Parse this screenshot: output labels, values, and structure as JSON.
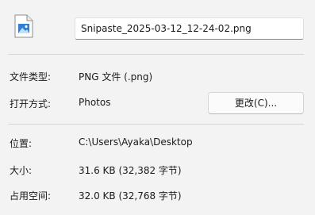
{
  "file": {
    "icon": "image-file-icon",
    "name": "Snipaste_2025-03-12_12-24-02.png"
  },
  "properties": {
    "type": {
      "label": "文件类型:",
      "value": "PNG 文件 (.png)"
    },
    "opens_with": {
      "label": "打开方式:",
      "value": "Photos",
      "change_button": "更改(C)..."
    },
    "location": {
      "label": "位置:",
      "value": "C:\\Users\\Ayaka\\Desktop"
    },
    "size": {
      "label": "大小:",
      "value": "31.6 KB (32,382 字节)"
    },
    "size_on_disk": {
      "label": "占用空间:",
      "value": "32.0 KB (32,768 字节)"
    }
  },
  "colors": {
    "background": "#f3f3f3",
    "icon_accent": "#2f7fd6"
  }
}
